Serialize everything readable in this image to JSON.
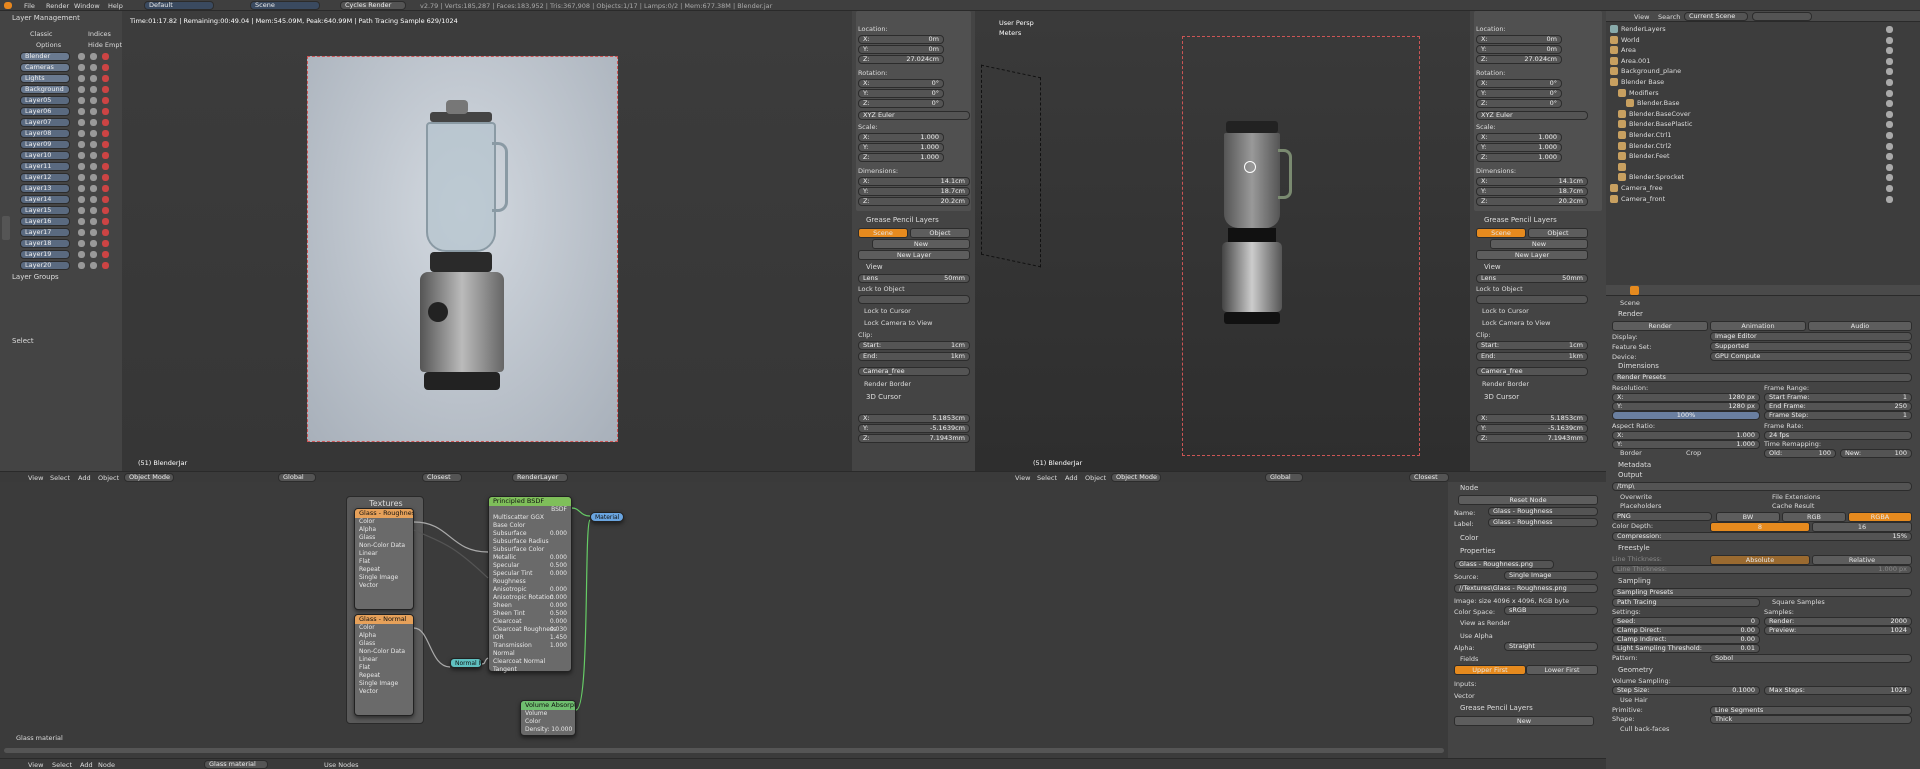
{
  "topbar": {
    "menus": [
      "File",
      "Render",
      "Window",
      "Help"
    ],
    "screen": "Default",
    "scene": "Scene",
    "engine": "Cycles Render",
    "stats": "v2.79 | Verts:185,287 | Faces:183,952 | Tris:367,908 | Objects:1/17 | Lamps:0/2 | Mem:677.38M | Blender.jar"
  },
  "layers": {
    "title": "Layer Management",
    "classic": "Classic",
    "indices": "Indices",
    "options": "Options",
    "hide_empty": "Hide Empty",
    "items": [
      "Blender",
      "Cameras",
      "Lights",
      "Background",
      "Layer05",
      "Layer06",
      "Layer07",
      "Layer08",
      "Layer09",
      "Layer10",
      "Layer11",
      "Layer12",
      "Layer13",
      "Layer14",
      "Layer15",
      "Layer16",
      "Layer17",
      "Layer18",
      "Layer19",
      "Layer20"
    ],
    "groups": "Layer Groups",
    "select": "Select"
  },
  "vp1": {
    "status": "Time:01:17.82 | Remaining:00:49.04 | Mem:545.09M, Peak:640.99M | Path Tracing Sample 629/1024",
    "object_label": "(51) BlenderJar",
    "menus": [
      "View",
      "Select",
      "Add",
      "Object"
    ],
    "mode": "Object Mode",
    "orientation": "Global",
    "snap": "Closest",
    "layer": "RenderLayer"
  },
  "vp2": {
    "persp": "User Persp",
    "units": "Meters",
    "object_label": "(51) BlenderJar",
    "menus": [
      "View",
      "Select",
      "Add",
      "Object"
    ],
    "mode": "Object Mode",
    "orientation": "Global",
    "snap": "Closest"
  },
  "npanel1": {
    "location": "Location:",
    "loc": [
      "X:",
      "0m",
      "Y:",
      "0m",
      "Z:",
      "27.024cm"
    ],
    "rotation": "Rotation:",
    "rot": [
      "X:",
      "0°",
      "Y:",
      "0°",
      "Z:",
      "0°"
    ],
    "euler": "XYZ Euler",
    "scale": "Scale:",
    "scl": [
      "X:",
      "1.000",
      "Y:",
      "1.000",
      "Z:",
      "1.000"
    ],
    "dimensions": "Dimensions:",
    "dim": [
      "X:",
      "14.1cm",
      "Y:",
      "18.7cm",
      "Z:",
      "20.2cm"
    ],
    "gp": "Grease Pencil Layers",
    "scene_btn": "Scene",
    "object_btn": "Object",
    "new_btn": "New",
    "new_layer": "New Layer",
    "view": "View",
    "lens": "Lens",
    "lens_val": "50mm",
    "lock_obj": "Lock to Object",
    "lock_cursor": "Lock to Cursor",
    "lock_cam": "Lock Camera to View",
    "clip": "Clip:",
    "start": "Start:",
    "start_val": "1cm",
    "end": "End:",
    "end_val": "1km",
    "camera": "Camera_free",
    "render_border": "Render Border",
    "cursor3d": "3D Cursor",
    "cloc": [
      "X:",
      "5.1853cm",
      "Y:",
      "-5.1639cm",
      "Z:",
      "7.1943mm"
    ]
  },
  "nodes": {
    "textures": "Textures",
    "tex1": {
      "name": "Glass - Roughness",
      "rows": [
        "Color",
        "Alpha",
        "Glass",
        "Non-Color Data",
        "Linear",
        "Flat",
        "Repeat",
        "Single Image",
        "Vector"
      ]
    },
    "tex2": {
      "name": "Glass - Normal",
      "rows": [
        "Color",
        "Alpha",
        "Glass",
        "Non-Color Data",
        "Linear",
        "Flat",
        "Repeat",
        "Single Image",
        "Vector"
      ]
    },
    "bsdf": {
      "name": "Principled BSDF",
      "out": "BSDF",
      "rows": [
        [
          "Multiscatter GGX",
          ""
        ],
        [
          "Base Color",
          ""
        ],
        [
          "Subsurface",
          "0.000"
        ],
        [
          "Subsurface Radius",
          ""
        ],
        [
          "Subsurface Color",
          ""
        ],
        [
          "Metallic",
          "0.000"
        ],
        [
          "Specular",
          "0.500"
        ],
        [
          "Specular Tint",
          "0.000"
        ],
        [
          "Roughness",
          ""
        ],
        [
          "Anisotropic",
          "0.000"
        ],
        [
          "Anisotropic Rotation",
          "0.000"
        ],
        [
          "Sheen",
          "0.000"
        ],
        [
          "Sheen Tint",
          "0.500"
        ],
        [
          "Clearcoat",
          "0.000"
        ],
        [
          "Clearcoat Roughness",
          "0.030"
        ],
        [
          "IOR",
          "1.450"
        ],
        [
          "Transmission",
          "1.000"
        ],
        [
          "Normal",
          ""
        ],
        [
          "Clearcoat Normal",
          ""
        ],
        [
          "Tangent",
          ""
        ]
      ]
    },
    "normalmap": "Normal M",
    "material": "Material",
    "volume": {
      "name": "Volume Absorption",
      "rows": [
        "Volume",
        "Color",
        "Density: 10.000"
      ]
    },
    "label": "Glass material",
    "bar_menus": [
      "View",
      "Select",
      "Add",
      "Node"
    ],
    "mat_name": "Glass material",
    "use_nodes": "Use Nodes"
  },
  "nodepanel": {
    "node": "Node",
    "reset": "Reset Node",
    "name_lbl": "Name:",
    "name_val": "Glass - Roughness",
    "label_lbl": "Label:",
    "label_val": "Glass - Roughness",
    "color": "Color",
    "properties": "Properties",
    "img": "Glass - Roughness.png",
    "source_lbl": "Source:",
    "source_val": "Single Image",
    "path": "//Textures\\Glass - Roughness.png",
    "info": "Image: size 4096 x 4096, RGB byte",
    "cs_lbl": "Color Space:",
    "cs_val": "sRGB",
    "view_render": "View as Render",
    "use_alpha": "Use Alpha",
    "alpha_lbl": "Alpha:",
    "alpha_val": "Straight",
    "fields": "Fields",
    "upper": "Upper First",
    "lower": "Lower First",
    "inputs": "Inputs:",
    "vector": "Vector",
    "gp": "Grease Pencil Layers",
    "new": "New"
  },
  "outliner": {
    "menus": [
      "View",
      "Search"
    ],
    "scene_sel": "Current Scene",
    "items": [
      "RenderLayers",
      "World",
      "Area",
      "Area.001",
      "Background_plane",
      "Blender Base",
      "Modifiers",
      "Blender.Base",
      "Blender.BaseCover",
      "Blender.BasePlastic",
      "Blender.Ctrl1",
      "Blender.Ctrl2",
      "Blender.Feet",
      "",
      "Blender.Sprocket",
      "Camera_free",
      "Camera_front"
    ]
  },
  "props": {
    "scene": "Scene",
    "render": "Render",
    "render_btn": "Render",
    "anim_btn": "Animation",
    "audio_btn": "Audio",
    "display": "Display:",
    "display_val": "Image Editor",
    "feature": "Feature Set:",
    "feature_val": "Supported",
    "device": "Device:",
    "device_val": "GPU Compute",
    "dimensions": "Dimensions",
    "presets": "Render Presets",
    "resolution": "Resolution:",
    "rx": "X:",
    "rx_val": "1280 px",
    "ry": "Y:",
    "ry_val": "1280 px",
    "rp": "100%",
    "frame_range": "Frame Range:",
    "start": "Start Frame:",
    "start_val": "1",
    "end": "End Frame:",
    "end_val": "250",
    "step": "Frame Step:",
    "step_val": "1",
    "aspect": "Aspect Ratio:",
    "ax": "X:",
    "ax_val": "1.000",
    "ay": "Y:",
    "ay_val": "1.000",
    "fps_lbl": "Frame Rate:",
    "fps": "24 fps",
    "remap": "Time Remapping:",
    "old": "Old:",
    "old_val": "100",
    "new": "New:",
    "new_val": "100",
    "border": "Border",
    "crop": "Crop",
    "metadata": "Metadata",
    "output": "Output",
    "path": "/tmp\\",
    "overwrite": "Overwrite",
    "ext": "File Extensions",
    "placeholders": "Placeholders",
    "cache": "Cache Result",
    "format": "PNG",
    "bw": "BW",
    "rgb": "RGB",
    "rgba": "RGBA",
    "depth_lbl": "Color Depth:",
    "d8": "8",
    "d16": "16",
    "compression": "Compression:",
    "comp_val": "15%",
    "freestyle": "Freestyle",
    "line_thick": "Line Thickness:",
    "absolute": "Absolute",
    "relative": "Relative",
    "lt": "Line Thickness:",
    "lt_val": "1.000 px",
    "sampling": "Sampling",
    "s_presets": "Sampling Presets",
    "pt": "Path Tracing",
    "square": "Square Samples",
    "settings": "Settings:",
    "samples": "Samples:",
    "seed": "Seed:",
    "seed_val": "0",
    "srender": "Render:",
    "srender_val": "2000",
    "clamp_d": "Clamp Direct:",
    "clamp_d_val": "0.00",
    "spreview": "Preview:",
    "spreview_val": "1024",
    "clamp_i": "Clamp Indirect:",
    "clamp_i_val": "0.00",
    "lst": "Light Sampling Threshold:",
    "lst_val": "0.01",
    "pattern": "Pattern:",
    "pattern_val": "Sobol",
    "geometry": "Geometry",
    "vol": "Volume Sampling:",
    "step_size": "Step Size:",
    "step_size_val": "0.1000",
    "max_steps": "Max Steps:",
    "max_steps_val": "1024",
    "hair": "Use Hair",
    "prim": "Primitive:",
    "prim_val": "Line Segments",
    "shape": "Shape:",
    "shape_val": "Thick",
    "cull": "Cull back-faces"
  }
}
